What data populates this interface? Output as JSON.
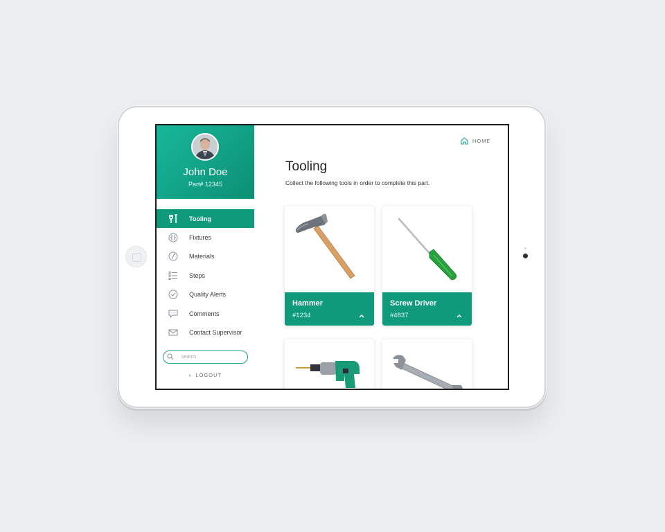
{
  "user": {
    "name": "John Doe",
    "part": "Part# 12345"
  },
  "nav": {
    "items": [
      {
        "label": "Tooling",
        "icon": "tools-icon",
        "active": true
      },
      {
        "label": "Fixtures",
        "icon": "fixtures-icon",
        "active": false
      },
      {
        "label": "Materials",
        "icon": "materials-icon",
        "active": false
      },
      {
        "label": "Steps",
        "icon": "steps-list-icon",
        "active": false
      },
      {
        "label": "Quality Alerts",
        "icon": "checkmark-circle-icon",
        "active": false
      },
      {
        "label": "Comments",
        "icon": "comment-icon",
        "active": false
      },
      {
        "label": "Contact Supervisor",
        "icon": "mail-icon",
        "active": false
      }
    ]
  },
  "search": {
    "placeholder": "search"
  },
  "logout": {
    "label": "LOGOUT"
  },
  "header": {
    "home_label": "HOME"
  },
  "page": {
    "title": "Tooling",
    "description": "Collect the following tools in order to complete this part."
  },
  "tools": [
    {
      "name": "Hammer",
      "id": "#1234",
      "image": "hammer"
    },
    {
      "name": "Screw Driver",
      "id": "#4837",
      "image": "screwdriver"
    },
    {
      "name": "",
      "id": "",
      "image": "drill"
    },
    {
      "name": "",
      "id": "",
      "image": "wrench"
    }
  ],
  "colors": {
    "accent": "#0e9a7b",
    "accent_light": "#18b79b",
    "background": "#eceef1"
  }
}
